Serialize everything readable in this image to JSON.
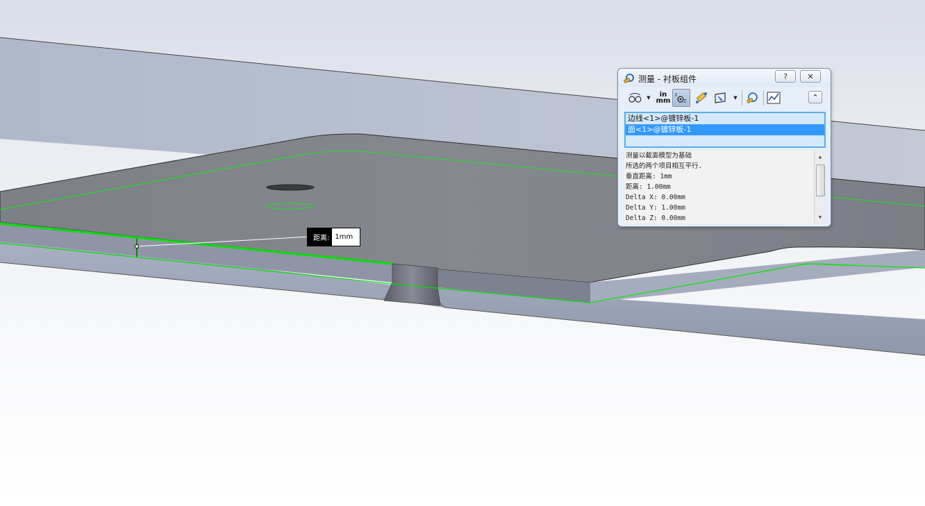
{
  "dialog": {
    "title": "测量 - 衬板组件",
    "help_label": "?",
    "close_label": "✕",
    "toolbar": {
      "arc_circle_icon": "arc-circle-measure-icon",
      "units_top": "in",
      "units_bottom": "mm",
      "xyz_icon": "xyz-delta-icon",
      "point_to_point_icon": "point-to-point-icon",
      "projection_icon": "projection-icon",
      "sensor_icon": "create-sensor-icon",
      "history_icon": "measure-history-icon",
      "collapse_label": "⌃",
      "dropdown_arrow": "▼"
    },
    "selections": [
      {
        "label": "边线<1>@镀锌板-1",
        "selected": false
      },
      {
        "label": "面<1>@镀锌板-1",
        "selected": true
      },
      {
        "label": "",
        "selected": false
      }
    ],
    "results": [
      "测量以截面模型为基础",
      "所选的两个项目相互平行.",
      "垂直距离: 1mm",
      "距离: 1.00mm",
      "Delta X: 0.00mm",
      "Delta Y: 1.00mm",
      "Delta Z: 0.00mm"
    ],
    "scroll_up": "▲",
    "scroll_down": "▼"
  },
  "callout": {
    "label": "距离:",
    "value": "1mm"
  },
  "colors": {
    "highlight_green": "#00e000",
    "selection_blue": "#3399ff",
    "plate_top": "#84878f",
    "plate_edge": "#9aa1b4",
    "background_plate": "#b4bccd"
  }
}
